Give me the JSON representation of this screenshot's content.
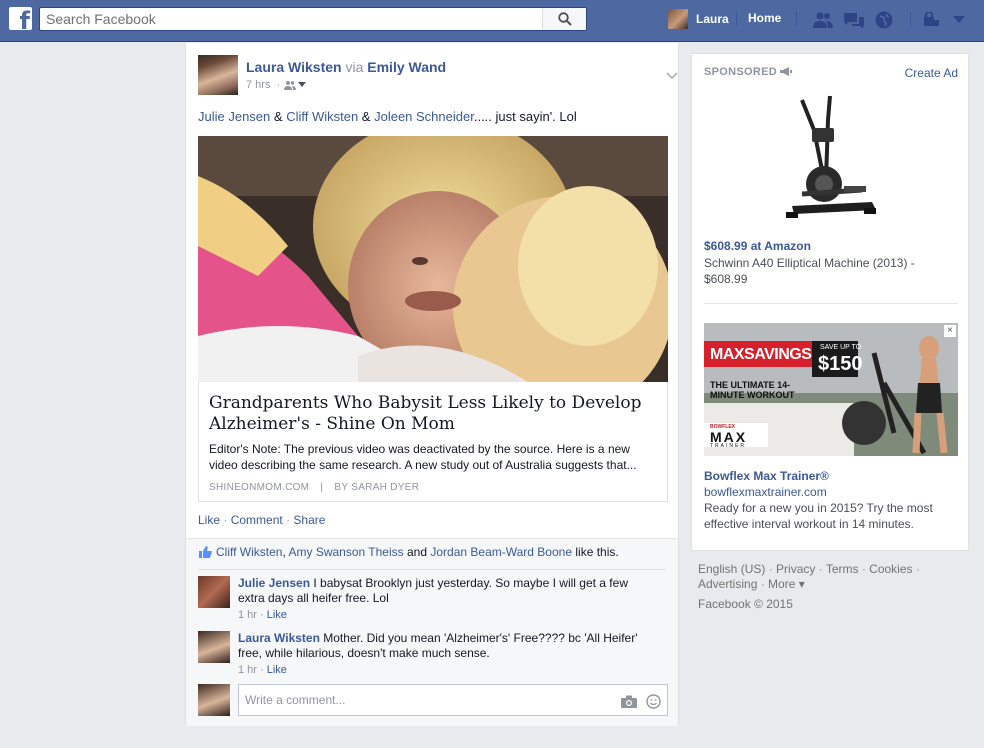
{
  "topbar": {
    "logo": "f",
    "search_placeholder": "Search Facebook",
    "user_name": "Laura",
    "home_label": "Home",
    "icons": [
      "friend-requests-icon",
      "messages-icon",
      "notifications-icon",
      "privacy-shortcuts-icon",
      "account-menu-icon"
    ]
  },
  "post": {
    "author": "Laura Wiksten",
    "via_text": "via",
    "via_name": "Emily Wand",
    "time": "7 hrs",
    "audience_icon": "friends-icon",
    "text": {
      "tag1": "Julie Jensen",
      "amp1": " & ",
      "tag2": "Cliff Wiksten",
      "amp2": " & ",
      "tag3": "Joleen Schneider",
      "rest": "..... just sayin'. Lol"
    },
    "link": {
      "title": "Grandparents Who Babysit Less Likely to Develop Alzheimer's - Shine On Mom",
      "description": "Editor's Note: The previous video was deactivated by the source. Here is a new video describing the same research. A new study out of Australia suggests that...",
      "source": "SHINEONMOM.COM",
      "separator": "|",
      "byline": "BY SARAH DYER"
    },
    "actions": {
      "like": "Like",
      "comment": "Comment",
      "share": "Share",
      "dot": "·"
    },
    "likes": {
      "name1": "Cliff Wiksten",
      "comma": ",",
      "name2": "Amy Swanson Theiss",
      "and": "and",
      "name3": "Jordan Beam-Ward Boone",
      "suffix": "like this."
    },
    "comments": [
      {
        "name": "Julie Jensen",
        "text": "I babysat Brooklyn just yesterday. So maybe I will get a few extra days all heifer free. Lol",
        "time": "1 hr",
        "like": "Like"
      },
      {
        "name": "Laura Wiksten",
        "text": "Mother. Did you mean 'Alzheimer's' Free???? bc 'All Heifer' free, while hilarious, doesn't make much sense.",
        "time": "1 hr",
        "like": "Like"
      }
    ],
    "comment_placeholder": "Write a comment..."
  },
  "ads": {
    "sponsored_label": "SPONSORED",
    "create_ad": "Create Ad",
    "ad1": {
      "title": "$608.99 at Amazon",
      "body": "Schwinn A40 Elliptical Machine (2013) - $608.99"
    },
    "ad2": {
      "banner_headline": "MAXSAVINGS",
      "banner_save_small": "SAVE UP TO",
      "banner_save_amount": "$150",
      "banner_sub": "THE ULTIMATE 14-MINUTE WORKOUT",
      "banner_brand_small": "BOWFLEX",
      "banner_brand": "MAX",
      "banner_brand_sub": "TRAINER",
      "close": "×",
      "title": "Bowflex Max Trainer®",
      "domain": "bowflexmaxtrainer.com",
      "body": "Ready for a new you in 2015? Try the most effective interval workout in 14 minutes."
    }
  },
  "footer": {
    "links": [
      "English (US)",
      "Privacy",
      "Terms",
      "Cookies",
      "Advertising",
      "More"
    ],
    "copyright": "Facebook © 2015"
  },
  "colors": {
    "brand": "#4e69a2",
    "link": "#3b5998",
    "muted": "#90949c",
    "page_bg": "#e9eaed"
  }
}
